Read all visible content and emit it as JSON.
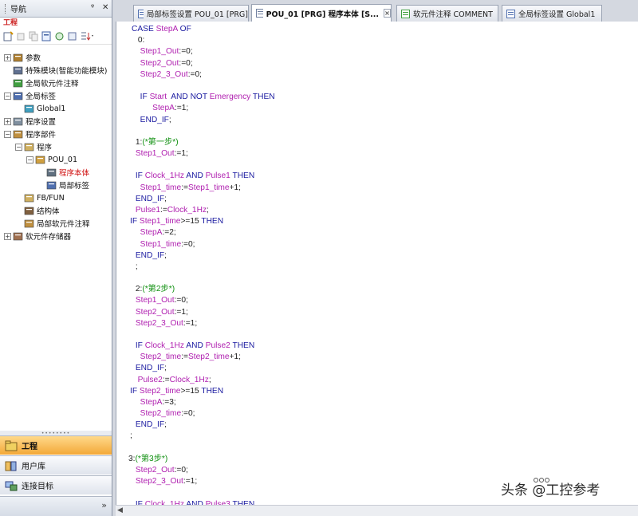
{
  "nav": {
    "title": "导航",
    "pin": "ᵠ",
    "close": "✕",
    "project_label": "工程",
    "tree": [
      {
        "label": "参数",
        "level": 0,
        "exp": "+"
      },
      {
        "label": "特殊模块(智能功能模块)",
        "level": 0,
        "exp": ""
      },
      {
        "label": "全局软元件注释",
        "level": 0,
        "exp": ""
      },
      {
        "label": "全局标签",
        "level": 0,
        "exp": "−"
      },
      {
        "label": "Global1",
        "level": 1,
        "exp": ""
      },
      {
        "label": "程序设置",
        "level": 0,
        "exp": "+"
      },
      {
        "label": "程序部件",
        "level": 0,
        "exp": "−"
      },
      {
        "label": "程序",
        "level": 1,
        "exp": "−"
      },
      {
        "label": "POU_01",
        "level": 2,
        "exp": "−"
      },
      {
        "label": "程序本体",
        "level": 3,
        "exp": ""
      },
      {
        "label": "局部标签",
        "level": 3,
        "exp": ""
      },
      {
        "label": "FB/FUN",
        "level": 1,
        "exp": ""
      },
      {
        "label": "结构体",
        "level": 1,
        "exp": ""
      },
      {
        "label": "局部软元件注释",
        "level": 1,
        "exp": ""
      },
      {
        "label": "软元件存储器",
        "level": 0,
        "exp": "+"
      }
    ],
    "bottom_buttons": [
      "工程",
      "用户库",
      "连接目标"
    ],
    "more": "»"
  },
  "tabs": [
    {
      "label": "局部标签设置 POU_01 [PRG]"
    },
    {
      "label": "POU_01 [PRG] 程序本体 [S..."
    },
    {
      "label": "软元件注释 COMMENT"
    },
    {
      "label": "全局标签设置 Global1"
    }
  ],
  "tab_close": "×",
  "code_lines": [
    "CASE StepA OF",
    " 0:",
    "  Step1_Out:=0;",
    "  Step2_Out:=0;",
    "  Step2_3_Out:=0;",
    "",
    "  IF Start  AND NOT Emergency THEN",
    "     StepA:=1;",
    "  END_IF;",
    "",
    " 1:(*第一步*)",
    " Step1_Out:=1;",
    "",
    " IF Clock_1Hz AND Pulse1 THEN",
    "  Step1_time:=Step1_time+1;",
    " END_IF;",
    " Pulse1:=Clock_1Hz;",
    "IF Step1_time>=15 THEN",
    "  StepA:=2;",
    "  Step1_time:=0;",
    " END_IF;",
    " ;",
    "",
    " 2:(*第2步*)",
    " Step1_Out:=0;",
    " Step2_Out:=1;",
    " Step2_3_Out:=1;",
    "",
    " IF Clock_1Hz AND Pulse2 THEN",
    "  Step2_time:=Step2_time+1;",
    " END_IF;",
    "  Pulse2:=Clock_1Hz;",
    "IF Step2_time>=15 THEN",
    "  StepA:=3;",
    "  Step2_time:=0;",
    " END_IF;",
    ";",
    "",
    "3:(*第3步*)",
    " Step2_Out:=0;",
    " Step2_3_Out:=1;",
    "",
    " IF Clock_1Hz AND Pulse3 THEN"
  ],
  "watermark": "头条 @工控参考",
  "colors": {
    "keyword": "#1a1aa0",
    "variable": "#b020b0",
    "comment": "#109010",
    "active_nav": "#f3a838",
    "selected_tree": "#d01010"
  },
  "keywords": [
    "CASE",
    "OF",
    "IF",
    "AND",
    "NOT",
    "THEN",
    "END_IF"
  ]
}
